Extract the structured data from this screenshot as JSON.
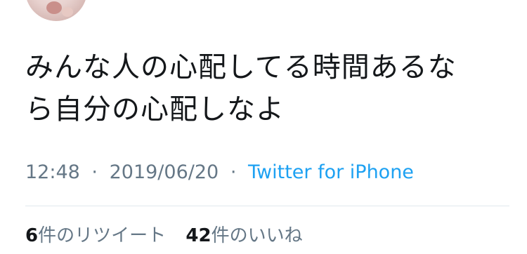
{
  "tweet": {
    "text_line1": "みんな人の心配してる時間あるな",
    "text_line2": "ら自分の心配しなよ",
    "time": "12:48",
    "date": "2019/06/20",
    "separator": "·",
    "source": "Twitter for iPhone"
  },
  "stats": {
    "retweets_count": "6",
    "retweets_label": "件のリツイート",
    "likes_count": "42",
    "likes_label": "件のいいね"
  },
  "colors": {
    "text": "#14171a",
    "meta": "#657786",
    "link": "#1da1f2",
    "divider": "#e1e8ed"
  }
}
